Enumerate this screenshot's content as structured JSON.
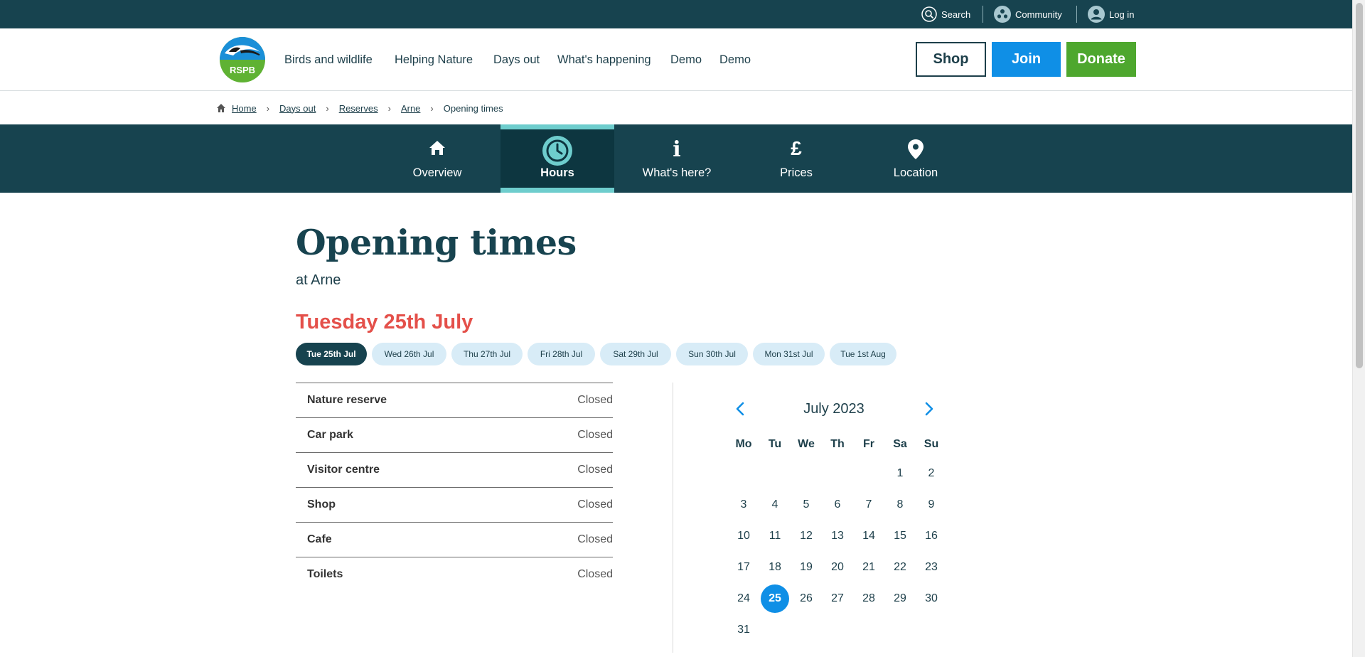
{
  "utility": {
    "search": "Search",
    "community": "Community",
    "login": "Log in"
  },
  "logo_text": "RSPB",
  "nav": [
    "Birds and wildlife",
    "Helping Nature",
    "Days out",
    "What's happening",
    "Demo",
    "Demo"
  ],
  "buttons": {
    "shop": "Shop",
    "join": "Join",
    "donate": "Donate"
  },
  "breadcrumb": [
    "Home",
    "Days out",
    "Reserves",
    "Arne",
    "Opening times"
  ],
  "tabs": [
    {
      "label": "Overview",
      "icon": "home-icon"
    },
    {
      "label": "Hours",
      "icon": "clock-icon",
      "active": true
    },
    {
      "label": "What's here?",
      "icon": "info-icon"
    },
    {
      "label": "Prices",
      "icon": "pound-icon"
    },
    {
      "label": "Location",
      "icon": "map-pin-icon"
    }
  ],
  "page": {
    "title": "Opening times",
    "subtitle": "at Arne",
    "date_title": "Tuesday 25th July"
  },
  "date_chips": [
    "Tue 25th Jul",
    "Wed 26th Jul",
    "Thu 27th Jul",
    "Fri 28th Jul",
    "Sat 29th Jul",
    "Sun 30th Jul",
    "Mon 31st Jul",
    "Tue 1st Aug"
  ],
  "hours": [
    {
      "name": "Nature reserve",
      "value": "Closed"
    },
    {
      "name": "Car park",
      "value": "Closed"
    },
    {
      "name": "Visitor centre",
      "value": "Closed"
    },
    {
      "name": "Shop",
      "value": "Closed"
    },
    {
      "name": "Cafe",
      "value": "Closed"
    },
    {
      "name": "Toilets",
      "value": "Closed"
    }
  ],
  "calendar": {
    "month": "July 2023",
    "weekdays": [
      "Mo",
      "Tu",
      "We",
      "Th",
      "Fr",
      "Sa",
      "Su"
    ],
    "first_weekday_index": 5,
    "days_in_month": 31,
    "selected_day": 25
  },
  "colors": {
    "brand_dark": "#17434f",
    "join_blue": "#0f8fe6",
    "donate_green": "#4ea72e",
    "date_red": "#e4504a",
    "accent_teal": "#6ecdcd",
    "chip_bg": "#d8ecf7"
  }
}
